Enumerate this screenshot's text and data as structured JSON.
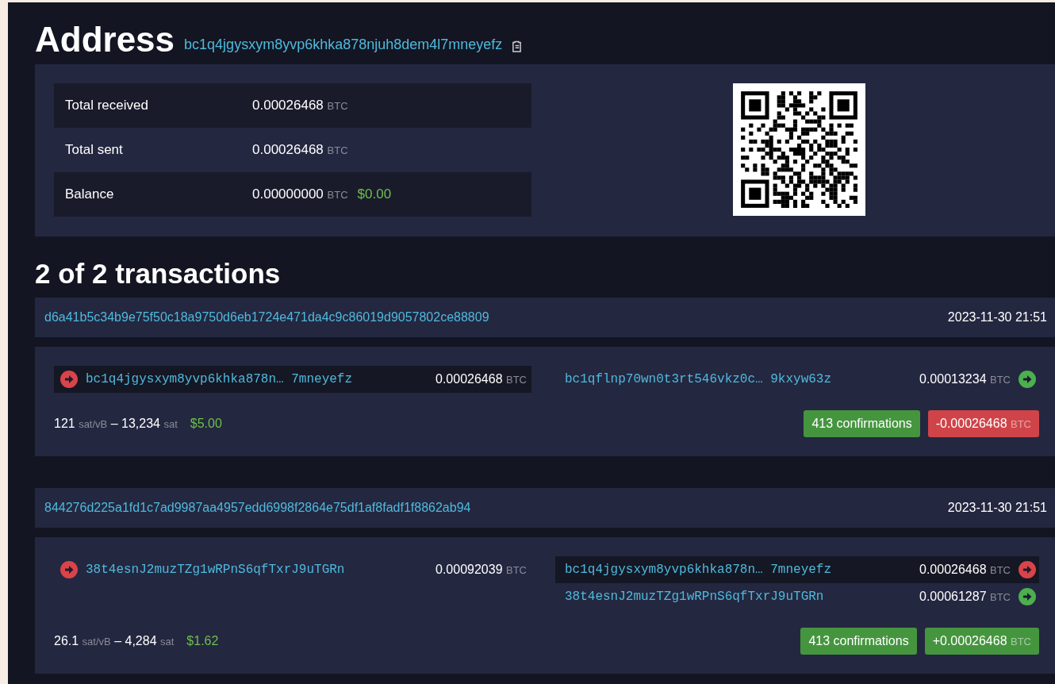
{
  "header": {
    "title": "Address",
    "address": "bc1q4jgysxym8yvp6khka878njuh8dem4l7mneyefz"
  },
  "summary": {
    "rows": [
      {
        "label": "Total received",
        "value": "0.00026468",
        "unit": "BTC"
      },
      {
        "label": "Total sent",
        "value": "0.00026468",
        "unit": "BTC"
      },
      {
        "label": "Balance",
        "value": "0.00000000",
        "unit": "BTC",
        "fiat": "$0.00"
      }
    ]
  },
  "transactions_heading": "2 of 2 transactions",
  "transactions": [
    {
      "txid": "d6a41b5c34b9e75f50c18a9750d6eb1724e471da4c9c86019d9057802ce88809",
      "time": "2023-11-30 21:51",
      "inputs": [
        {
          "address": "bc1q4jgysxym8yvp6khka878n… 7mneyefz",
          "amount": "0.00026468",
          "unit": "BTC",
          "highlighted": true,
          "spent": true
        }
      ],
      "outputs": [
        {
          "address": "bc1qflnp70wn0t3rt546vkz0c… 9kxyw63z",
          "amount": "0.00013234",
          "unit": "BTC",
          "highlighted": false,
          "spent": false
        }
      ],
      "fee": {
        "rate": "121",
        "rate_unit": "sat/vB",
        "separator": "–",
        "total": "13,234",
        "total_unit": "sat",
        "fiat": "$5.00"
      },
      "confirmations": "413 confirmations",
      "net": {
        "amount": "-0.00026468",
        "unit": "BTC",
        "negative": true
      }
    },
    {
      "txid": "844276d225a1fd1c7ad9987aa4957edd6998f2864e75df1af8fadf1f8862ab94",
      "time": "2023-11-30 21:51",
      "inputs": [
        {
          "address": "38t4esnJ2muzTZg1wRPnS6qfTxrJ9uTGRn",
          "amount": "0.00092039",
          "unit": "BTC",
          "highlighted": false,
          "spent": true
        }
      ],
      "outputs": [
        {
          "address": "bc1q4jgysxym8yvp6khka878n… 7mneyefz",
          "amount": "0.00026468",
          "unit": "BTC",
          "highlighted": true,
          "spent": true
        },
        {
          "address": "38t4esnJ2muzTZg1wRPnS6qfTxrJ9uTGRn",
          "amount": "0.00061287",
          "unit": "BTC",
          "highlighted": false,
          "spent": false
        }
      ],
      "fee": {
        "rate": "26.1",
        "rate_unit": "sat/vB",
        "separator": "–",
        "total": "4,284",
        "total_unit": "sat",
        "fiat": "$1.62"
      },
      "confirmations": "413 confirmations",
      "net": {
        "amount": "+0.00026468",
        "unit": "BTC",
        "negative": false
      }
    }
  ]
}
